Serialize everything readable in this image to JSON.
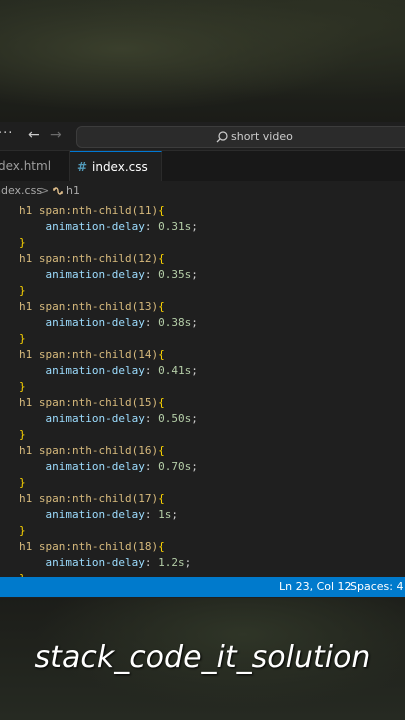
{
  "titlebar": {
    "search_text": "short video"
  },
  "tabs": [
    {
      "label": "dex.html"
    },
    {
      "label": "index.css",
      "icon": "#",
      "active": true
    }
  ],
  "breadcrumb": {
    "file": "ndex.css",
    "separator": ">",
    "symbol": "h1"
  },
  "code": [
    [
      {
        "t": "h1 span:nth-child(11)",
        "c": "sel"
      },
      {
        "t": "{",
        "c": "brace"
      }
    ],
    [
      {
        "t": "    animation-delay",
        "c": "prop"
      },
      {
        "t": ": ",
        "c": "punct"
      },
      {
        "t": "0.31s",
        "c": "val"
      },
      {
        "t": ";",
        "c": "punct"
      }
    ],
    [
      {
        "t": "}",
        "c": "brace"
      }
    ],
    [
      {
        "t": "h1 span:nth-child(12)",
        "c": "sel"
      },
      {
        "t": "{",
        "c": "brace"
      }
    ],
    [
      {
        "t": "    animation-delay",
        "c": "prop"
      },
      {
        "t": ": ",
        "c": "punct"
      },
      {
        "t": "0.35s",
        "c": "val"
      },
      {
        "t": ";",
        "c": "punct"
      }
    ],
    [
      {
        "t": "}",
        "c": "brace"
      }
    ],
    [
      {
        "t": "h1 span:nth-child(13)",
        "c": "sel"
      },
      {
        "t": "{",
        "c": "brace"
      }
    ],
    [
      {
        "t": "    animation-delay",
        "c": "prop"
      },
      {
        "t": ": ",
        "c": "punct"
      },
      {
        "t": "0.38s",
        "c": "val"
      },
      {
        "t": ";",
        "c": "punct"
      }
    ],
    [
      {
        "t": "}",
        "c": "brace"
      }
    ],
    [
      {
        "t": "h1 span:nth-child(14)",
        "c": "sel"
      },
      {
        "t": "{",
        "c": "brace"
      }
    ],
    [
      {
        "t": "    animation-delay",
        "c": "prop"
      },
      {
        "t": ": ",
        "c": "punct"
      },
      {
        "t": "0.41s",
        "c": "val"
      },
      {
        "t": ";",
        "c": "punct"
      }
    ],
    [
      {
        "t": "}",
        "c": "brace"
      }
    ],
    [
      {
        "t": "h1 span:nth-child(15)",
        "c": "sel"
      },
      {
        "t": "{",
        "c": "brace"
      }
    ],
    [
      {
        "t": "    animation-delay",
        "c": "prop"
      },
      {
        "t": ": ",
        "c": "punct"
      },
      {
        "t": "0.50s",
        "c": "val"
      },
      {
        "t": ";",
        "c": "punct"
      }
    ],
    [
      {
        "t": "}",
        "c": "brace"
      }
    ],
    [
      {
        "t": "h1 span:nth-child(16)",
        "c": "sel"
      },
      {
        "t": "{",
        "c": "brace"
      }
    ],
    [
      {
        "t": "    animation-delay",
        "c": "prop"
      },
      {
        "t": ": ",
        "c": "punct"
      },
      {
        "t": "0.70s",
        "c": "val"
      },
      {
        "t": ";",
        "c": "punct"
      }
    ],
    [
      {
        "t": "}",
        "c": "brace"
      }
    ],
    [
      {
        "t": "h1 span:nth-child(17)",
        "c": "sel"
      },
      {
        "t": "{",
        "c": "brace"
      }
    ],
    [
      {
        "t": "    animation-delay",
        "c": "prop"
      },
      {
        "t": ": ",
        "c": "punct"
      },
      {
        "t": "1s",
        "c": "val"
      },
      {
        "t": ";",
        "c": "punct"
      }
    ],
    [
      {
        "t": "}",
        "c": "brace"
      }
    ],
    [
      {
        "t": "h1 span:nth-child(18)",
        "c": "sel"
      },
      {
        "t": "{",
        "c": "brace"
      }
    ],
    [
      {
        "t": "    animation-delay",
        "c": "prop"
      },
      {
        "t": ": ",
        "c": "punct"
      },
      {
        "t": "1.2s",
        "c": "val"
      },
      {
        "t": ";",
        "c": "punct"
      }
    ],
    [
      {
        "t": "}",
        "c": "brace"
      }
    ]
  ],
  "statusbar": {
    "position": "Ln 23, Col 12",
    "spaces": "Spaces: 4"
  },
  "caption": "stack_code_it_solution",
  "colors": {
    "statusbar": "#007acc",
    "editor_bg": "#1f1f1f",
    "selector": "#d7ba7d",
    "brace": "#ffd700",
    "property": "#9cdcfe",
    "number": "#b5cea8",
    "active_tab_border": "#0078d4"
  },
  "icons": [
    "more-icon",
    "arrow-left-icon",
    "arrow-right-icon",
    "search-icon",
    "css-file-icon",
    "symbol-icon"
  ]
}
